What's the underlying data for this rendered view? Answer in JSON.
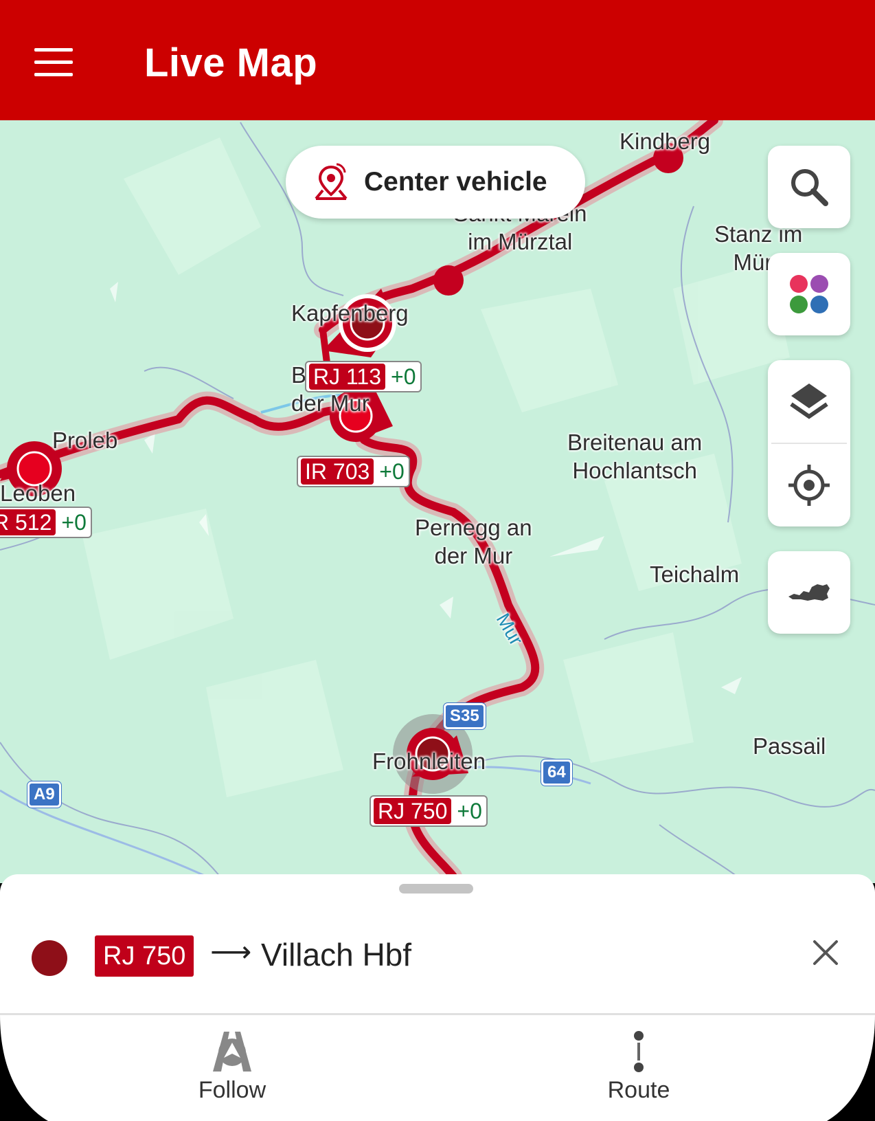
{
  "app": {
    "title": "Live Map"
  },
  "center_button": {
    "label": "Center vehicle"
  },
  "fabs": {
    "search": "search-icon",
    "stations": "colored-dots-icon",
    "layers": "layers-icon",
    "locate": "crosshair-icon",
    "country": "austria-map-icon"
  },
  "places": {
    "kindberg": "Kindberg",
    "st_marein": "Sankt Marein\nim Mürztal",
    "stanz": "Stanz im\nMürz",
    "kapfenberg": "Kapfenberg",
    "bruck": "Bruck an\nder Mur",
    "proleb": "Proleb",
    "leoben": "Leoben",
    "breitenau": "Breitenau am\nHochlantsch",
    "pernegg": "Pernegg an\nder Mur",
    "teichalm": "Teichalm",
    "frohnleiten": "Frohnleiten",
    "passail": "Passail",
    "river": "Mur"
  },
  "roads": {
    "s35": "S35",
    "r64": "64",
    "a9": "A9"
  },
  "trains": [
    {
      "number": "RJ 113",
      "delay": "+0"
    },
    {
      "number": "IR 703",
      "delay": "+0"
    },
    {
      "number": "R 512",
      "delay": "+0"
    },
    {
      "number": "RJ 750",
      "delay": "+0"
    }
  ],
  "selected": {
    "number": "RJ 750",
    "arrow": "⟶",
    "destination": "Villach Hbf"
  },
  "nav": {
    "follow": "Follow",
    "route": "Route"
  },
  "colors": {
    "brand": "#cc0000",
    "train_dark": "#8e0f18",
    "map": "#c9f0dc"
  }
}
